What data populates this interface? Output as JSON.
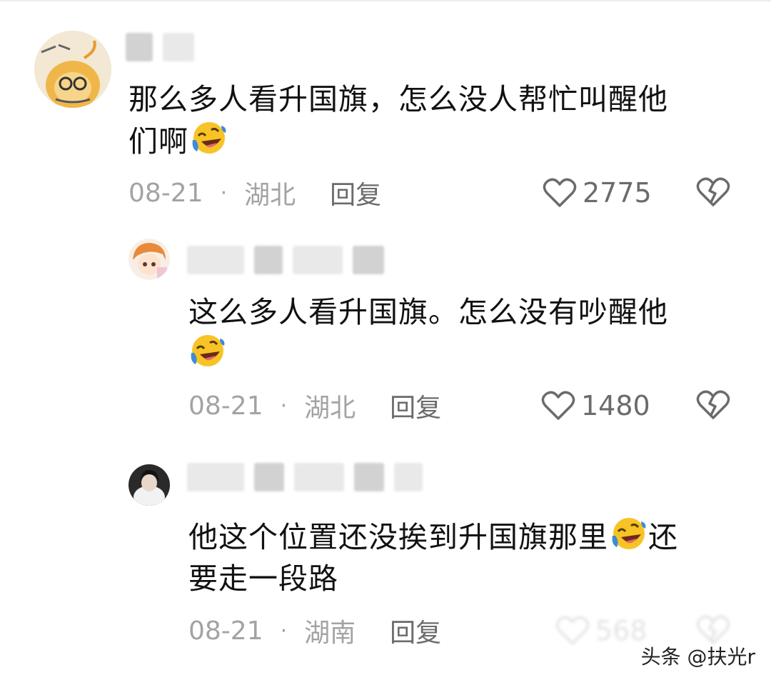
{
  "comments": [
    {
      "text": "那么多人看升国旗，怎么没人帮忙叫醒他们啊",
      "text_line1": "那么多人看升国旗，怎么没人帮忙叫醒他",
      "text_line2": "们啊",
      "date": "08-21",
      "separator": "·",
      "location": "湖北",
      "reply_label": "回复",
      "likes": "2775"
    },
    {
      "text_line1": "这么多人看升国旗。怎么没有吵醒他",
      "date": "08-21",
      "separator": "·",
      "location": "湖北",
      "reply_label": "回复",
      "likes": "1480"
    },
    {
      "text_line1_a": "他这个位置还没挨到升国旗那里",
      "text_line1_b": "还",
      "text_line2": "要走一段路",
      "date": "08-21",
      "separator": "·",
      "location": "湖南",
      "reply_label": "回复",
      "likes": "568"
    }
  ],
  "icons": {
    "emoji": "rolling-on-floor-laughing-emoji",
    "like": "heart-outline-icon",
    "dislike": "broken-heart-icon"
  },
  "colors": {
    "text": "#111111",
    "meta": "#a3a3a3",
    "reply": "#6b6b6b",
    "emoji_face": "#f7c325",
    "emoji_tear": "#3d8bd8"
  },
  "watermark": "头条 @扶光r"
}
